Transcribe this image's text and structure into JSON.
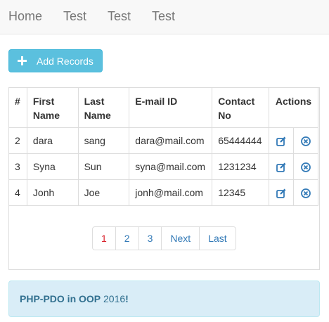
{
  "nav": {
    "items": [
      "Home",
      "Test",
      "Test",
      "Test"
    ]
  },
  "add_button": {
    "label": "Add Records"
  },
  "table": {
    "headers": {
      "id": "#",
      "first_name_1": "First",
      "first_name_2": "Name",
      "last_name_1": "Last",
      "last_name_2": "Name",
      "email": "E-mail ID",
      "contact_1": "Contact",
      "contact_2": "No",
      "actions": "Actions"
    },
    "rows": [
      {
        "id": "2",
        "first": "dara",
        "last": "sang",
        "email": "dara@mail.com",
        "contact": "65444444"
      },
      {
        "id": "3",
        "first": "Syna",
        "last": "Sun",
        "email": "syna@mail.com",
        "contact": "1231234"
      },
      {
        "id": "4",
        "first": "Jonh",
        "last": "Joe",
        "email": "jonh@mail.com",
        "contact": "12345"
      }
    ],
    "action_icons": {
      "edit": "edit-icon",
      "delete": "remove-circle-icon"
    }
  },
  "pagination": {
    "items": [
      "1",
      "2",
      "3",
      "Next",
      "Last"
    ]
  },
  "footer": {
    "bold_text": "PHP-PDO in OOP",
    "year": "2016",
    "exclaim": "!"
  },
  "colors": {
    "primary_button": "#5bc0de",
    "link": "#337ab7",
    "current_page": "#d9232d",
    "alert_bg": "#d9edf7",
    "alert_text": "#31708f"
  }
}
